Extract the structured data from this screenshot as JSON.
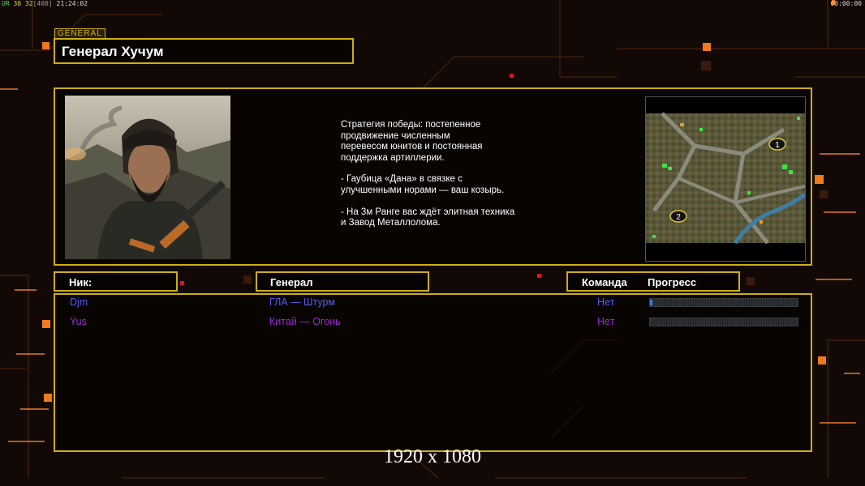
{
  "hud": {
    "left_flag": "UR",
    "fps_a": "30",
    "fps_b": "32",
    "fps_max": "[400]",
    "clock": "21:24:02",
    "right_timer": "00:00:00"
  },
  "general_tag": "GENERAL",
  "title": "Генерал Хучум",
  "description": {
    "p1": [
      "Стратегия победы: постепенное",
      "продвижение численным",
      "перевесом юнитов и постоянная",
      "поддержка артиллерии."
    ],
    "p2": [
      "- Гаубица «Дана» в связке с",
      "улучшенными норами — ваш козырь."
    ],
    "p3": [
      "- На 3м Ранге вас ждёт элитная техника",
      "и Завод Металлолома."
    ]
  },
  "minimap": {
    "start_1": "1",
    "start_2": "2"
  },
  "headers": {
    "nick": "Ник:",
    "general": "Генерал",
    "team": "Команда",
    "progress": "Прогресс"
  },
  "players": [
    {
      "nick": "Djm",
      "general": "ГЛА — Штурм",
      "team": "Нет",
      "progress": 0.015,
      "color": "#5a5cf0"
    },
    {
      "nick": "Yus",
      "general": "Китай — Огонь",
      "team": "Нет",
      "progress": 0.0,
      "color": "#9a2cd0"
    }
  ],
  "accent_color": "#cfae12",
  "resolution_label": "1920 x 1080"
}
